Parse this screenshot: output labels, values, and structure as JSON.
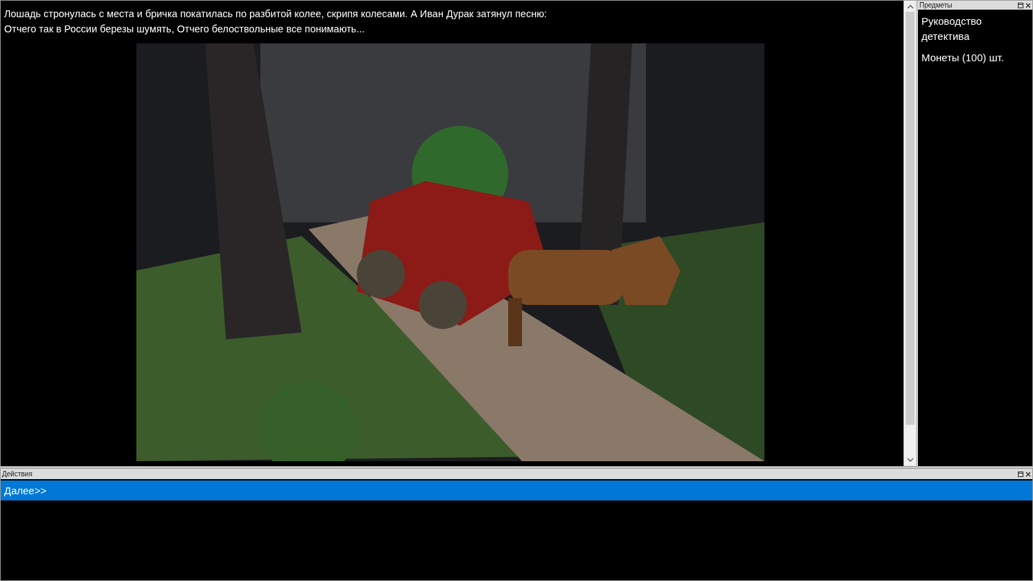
{
  "main": {
    "lines": [
      "Лошадь стронулась с места и бричка покатилась по разбитой колее, скрипя колесами. А Иван Дурак затянул песню:",
      "Отчего так в России березы шумять, Отчего белоствольные все понимають..."
    ]
  },
  "inventory": {
    "title": "Предметы",
    "items": [
      {
        "label": "Руководство детектива"
      },
      {
        "label": "Монеты (100) шт."
      }
    ]
  },
  "actions": {
    "title": "Действия",
    "items": [
      {
        "label": "Далее>>",
        "selected": true
      }
    ]
  }
}
